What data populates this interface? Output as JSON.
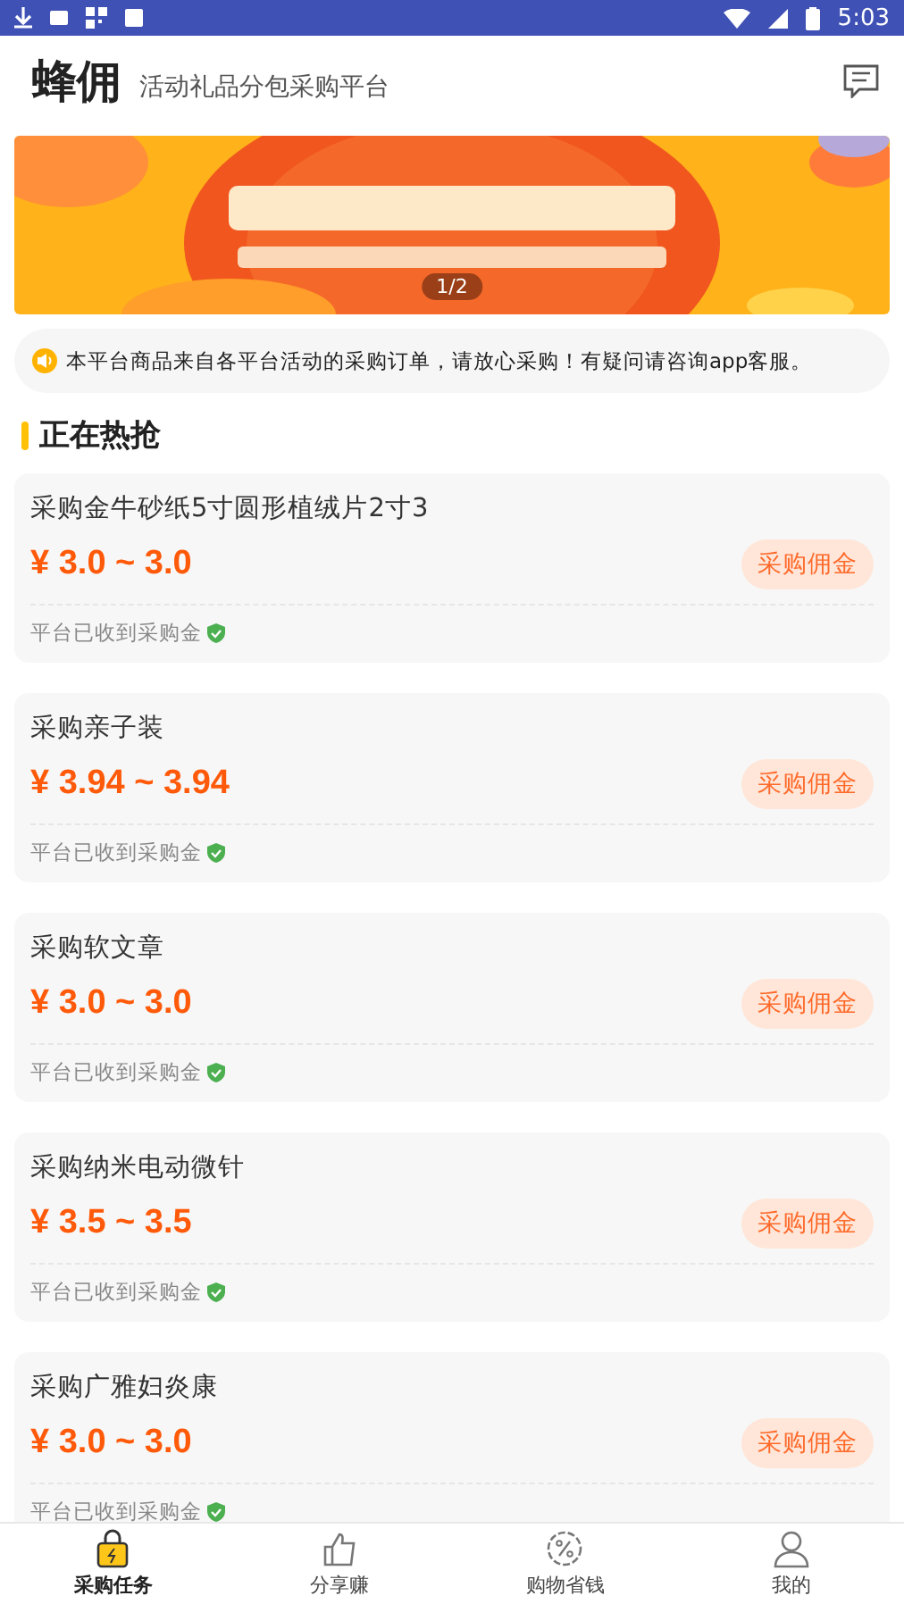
{
  "status_bar": {
    "time": "5:03"
  },
  "header": {
    "title": "蜂佣",
    "subtitle": "活动礼品分包采购平台"
  },
  "banner": {
    "pager": "1/2"
  },
  "notice": "本平台商品来自各平台活动的采购订单，请放心采购！有疑问请咨询app客服。",
  "section_title": "正在热抢",
  "tasks": [
    {
      "title": "采购金牛砂纸5寸圆形植绒片2寸3",
      "price": "¥ 3.0 ~ 3.0",
      "tag": "采购佣金",
      "footer": "平台已收到采购金",
      "verified": true
    },
    {
      "title": "采购亲子装",
      "price": "¥ 3.94 ~ 3.94",
      "tag": "采购佣金",
      "footer": "平台已收到采购金",
      "verified": true
    },
    {
      "title": "采购软文章",
      "price": "¥ 3.0 ~ 3.0",
      "tag": "采购佣金",
      "footer": "平台已收到采购金",
      "verified": true
    },
    {
      "title": "采购纳米电动微针",
      "price": "¥ 3.5 ~ 3.5",
      "tag": "采购佣金",
      "footer": "平台已收到采购金",
      "verified": true
    },
    {
      "title": "采购广雅妇炎康",
      "price": "¥ 3.0 ~ 3.0",
      "tag": "采购佣金",
      "footer": "平台已收到采购金",
      "verified": true
    }
  ],
  "tab_bar": [
    {
      "kind": "bag",
      "label": "采购任务",
      "selected": true
    },
    {
      "kind": "thumb",
      "label": "分享赚",
      "selected": false
    },
    {
      "kind": "discount",
      "label": "购物省钱",
      "selected": false
    },
    {
      "kind": "person",
      "label": "我的",
      "selected": false
    }
  ]
}
